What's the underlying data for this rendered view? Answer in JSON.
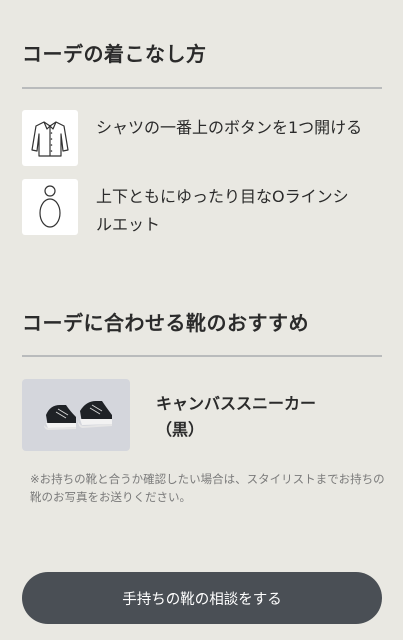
{
  "section1": {
    "title": "コーデの着こなし方",
    "tips": [
      {
        "icon": "shirt-icon",
        "text": "シャツの一番上のボタンを1つ開ける"
      },
      {
        "icon": "o-line-silhouette-icon",
        "text": "上下ともにゆったり目なOラインシルエット"
      }
    ]
  },
  "section2": {
    "title": "コーデに合わせる靴のおすすめ",
    "shoe": {
      "name": "キャンバススニーカー（黒）",
      "image": "black-canvas-sneakers"
    },
    "note": "※お持ちの靴と合うか確認したい場合は、スタイリストまでお持ちの靴のお写真をお送りください。"
  },
  "cta": {
    "label": "手持ちの靴の相談をする"
  },
  "colors": {
    "background": "#e9e8e2",
    "button": "#4a4f55",
    "divider": "#b9bbbc"
  }
}
